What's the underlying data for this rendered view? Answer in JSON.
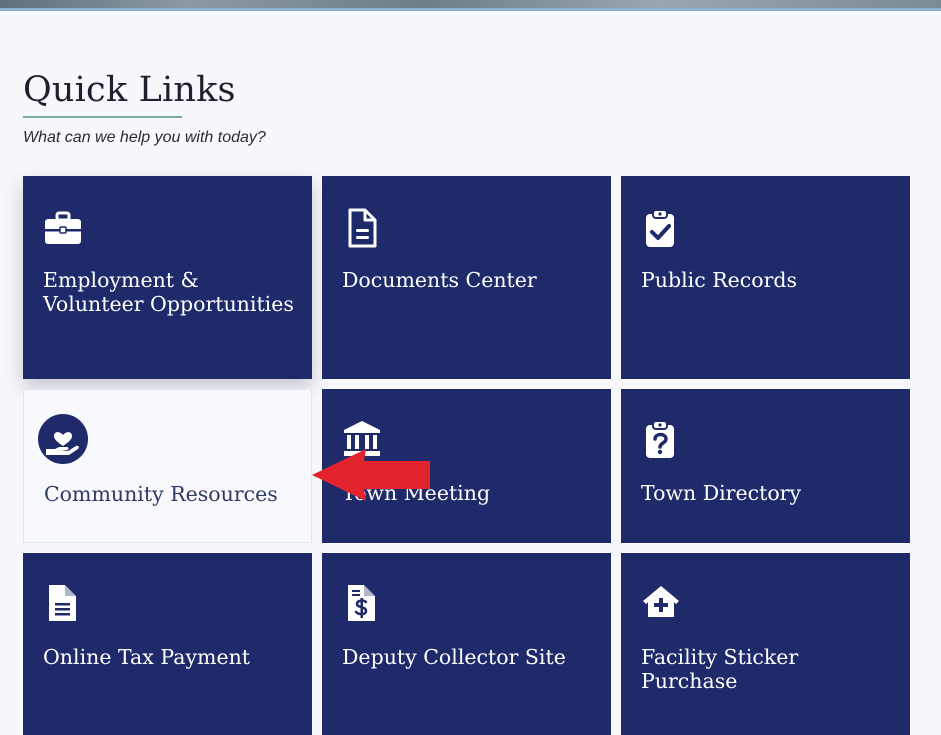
{
  "section": {
    "title": "Quick Links",
    "subtitle": "What can we help you with today?"
  },
  "tiles": [
    {
      "label": "Employment & Volunteer Opportunities",
      "icon": "briefcase-icon"
    },
    {
      "label": "Documents Center",
      "icon": "document-icon"
    },
    {
      "label": "Public Records",
      "icon": "clipboard-check-icon"
    },
    {
      "label": "Community Resources",
      "icon": "hand-heart-icon"
    },
    {
      "label": "Town Meeting",
      "icon": "government-building-icon"
    },
    {
      "label": "Town Directory",
      "icon": "clipboard-question-icon"
    },
    {
      "label": "Online Tax Payment",
      "icon": "file-lines-icon"
    },
    {
      "label": "Deputy Collector Site",
      "icon": "file-dollar-icon"
    },
    {
      "label": "Facility Sticker Purchase",
      "icon": "house-plus-icon"
    }
  ],
  "colors": {
    "tile_background": "#1e2a69",
    "tile_text": "#ffffff",
    "accent_underline": "#7fa7a5",
    "annotation_arrow": "#e3232d"
  }
}
